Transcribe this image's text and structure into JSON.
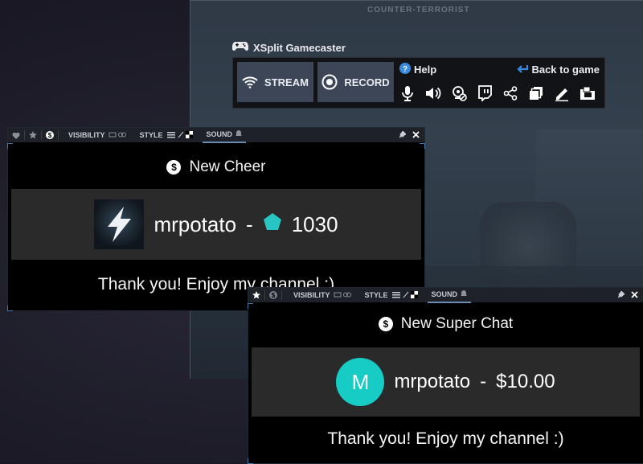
{
  "game": {
    "title": "COUNTER-TERRORIST"
  },
  "gamecaster": {
    "app_title": "XSplit Gamecaster",
    "stream_label": "STREAM",
    "record_label": "RECORD",
    "help_label": "Help",
    "back_label": "Back to game",
    "icons": [
      "microphone-icon",
      "speaker-icon",
      "webcam-off-icon",
      "twitch-icon",
      "share-icon",
      "layers-icon",
      "edit-icon",
      "screenshot-folder-icon"
    ]
  },
  "toolbar": {
    "visibility_label": "VISIBILITY",
    "style_label": "STYLE",
    "sound_label": "SOUND"
  },
  "cheer_alert": {
    "heading": "New Cheer",
    "username": "mrpotato",
    "separator": "-",
    "amount": "1030",
    "message": "Thank you! Enjoy my channel :)"
  },
  "superchat_alert": {
    "heading": "New Super Chat",
    "avatar_letter": "M",
    "username": "mrpotato",
    "separator": "-",
    "amount": "$10.00",
    "message": "Thank you! Enjoy my channel :)"
  },
  "colors": {
    "accent": "#17ccc4",
    "button_bg": "#3c4656"
  }
}
